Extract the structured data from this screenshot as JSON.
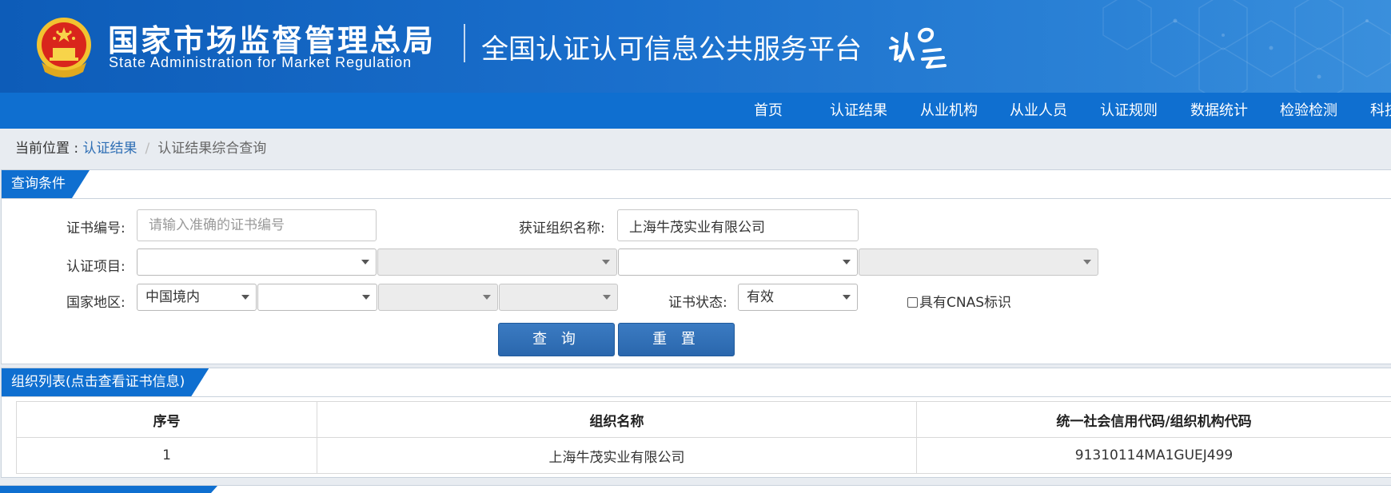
{
  "header": {
    "title_cn": "国家市场监督管理总局",
    "title_en": "State Administration  for  Market Regulation",
    "platform_title": "全国认证认可信息公共服务平台",
    "colors": {
      "header_blue": "#1a6fcc",
      "nav_blue": "#0f6fd0"
    },
    "emblem_icon": "national-emblem-icon",
    "logo_icon": "renzheng-yun-logo-icon"
  },
  "nav": {
    "items": [
      "首页",
      "认证结果",
      "从业机构",
      "从业人员",
      "认证规则",
      "数据统计",
      "检验检测",
      "科技"
    ]
  },
  "breadcrumb": {
    "prefix": "当前位置 : ",
    "link": "认证结果",
    "separator": "/",
    "current": "认证结果综合查询"
  },
  "query": {
    "section_title": "查询条件",
    "cert_no_label": "证书编号:",
    "cert_no_placeholder": "请输入准确的证书编号",
    "cert_no_value": "",
    "org_name_label": "获证组织名称:",
    "org_name_value": "上海牛茂实业有限公司",
    "project_label": "认证项目:",
    "project_selects": [
      "",
      "",
      "",
      ""
    ],
    "region_label": "国家地区:",
    "region_selects": [
      "中国境内",
      "",
      "",
      ""
    ],
    "status_label": "证书状态:",
    "status_value": "有效",
    "cnas_label": "具有CNAS标识",
    "cnas_checked": false,
    "search_button": "查 询",
    "reset_button": "重 置"
  },
  "org_list": {
    "section_title": "组织列表(点击查看证书信息)",
    "columns": [
      "序号",
      "组织名称",
      "统一社会信用代码/组织机构代码"
    ],
    "rows": [
      [
        "1",
        "上海牛茂实业有限公司",
        "91310114MA1GUEJ499"
      ]
    ]
  }
}
